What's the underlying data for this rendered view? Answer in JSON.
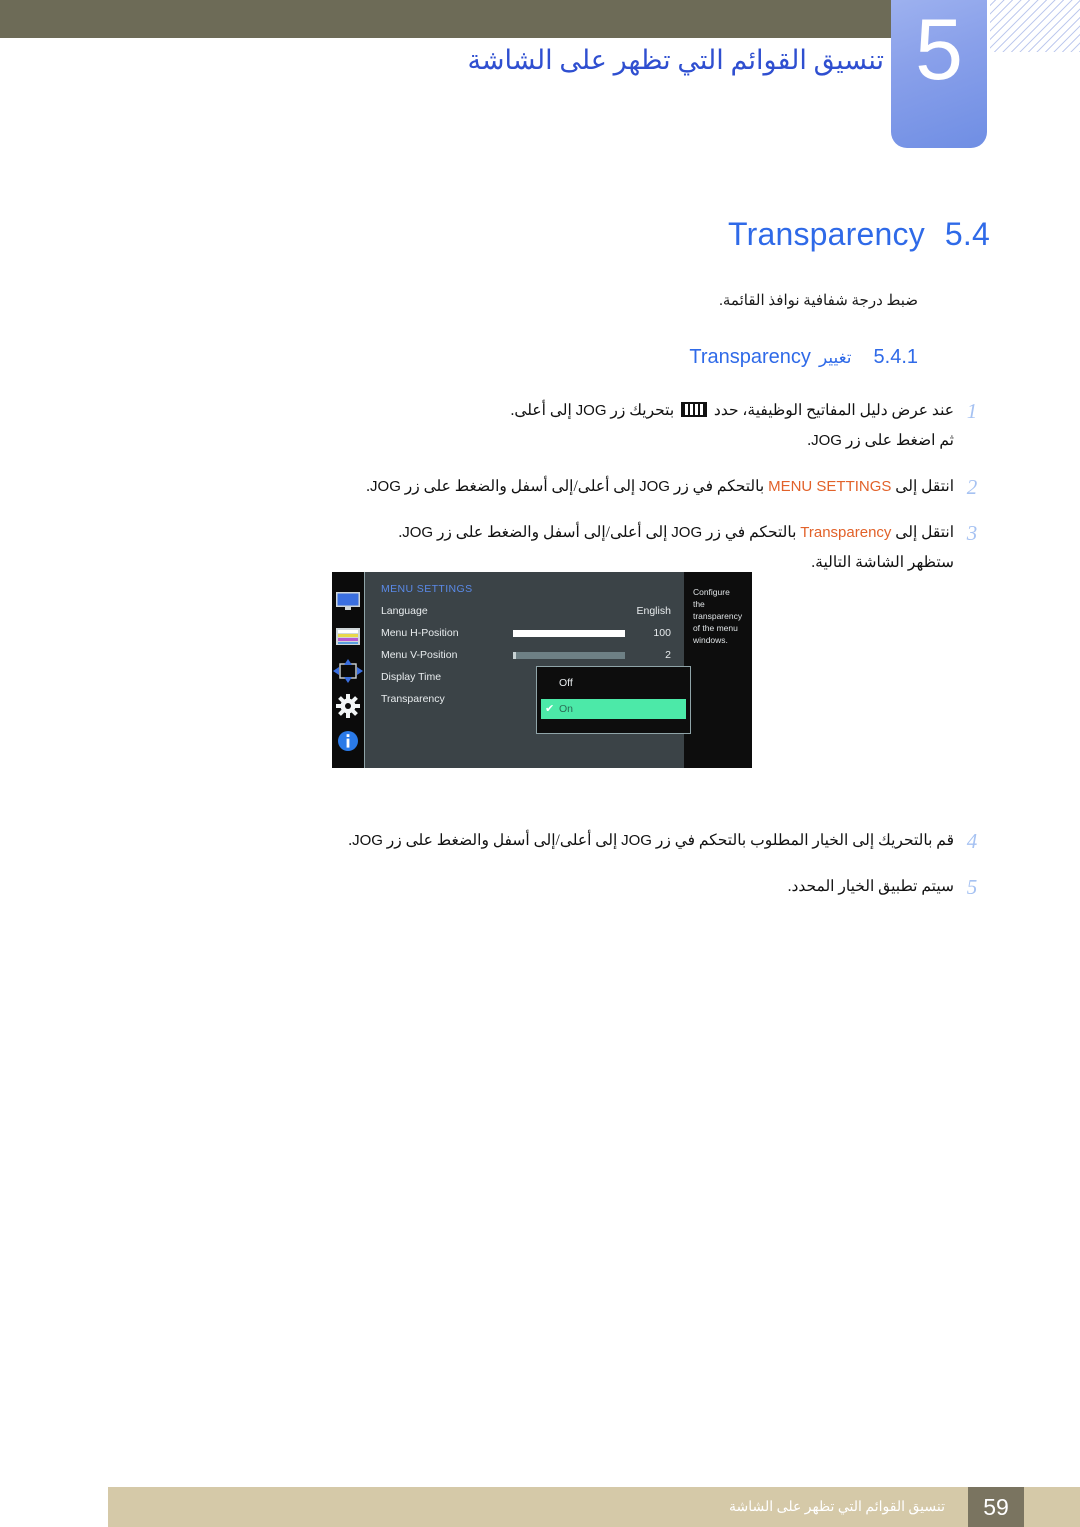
{
  "header": {
    "chapter_number": "5",
    "chapter_title": "تنسيق القوائم التي تظهر على الشاشة"
  },
  "section": {
    "number": "5.4",
    "title": "Transparency",
    "description": "ضبط درجة شفافية نوافذ القائمة."
  },
  "subsection": {
    "number": "5.4.1",
    "arabic_label": "تغيير",
    "english_label": "Transparency"
  },
  "steps": [
    {
      "number": "1",
      "line1_a": "عند عرض دليل المفاتيح الوظيفية، حدد ",
      "icon": "menu-bars-icon",
      "line1_b": " بتحريك زر ",
      "jog": "JOG",
      "line1_c": " إلى أعلى.",
      "line2_a": "ثم اضغط على زر ",
      "line2_jog": "JOG",
      "line2_b": "."
    },
    {
      "number": "2",
      "text_a": "انتقل إلى ",
      "highlight": "MENU SETTINGS",
      "text_b": " بالتحكم في زر ",
      "jog1": "JOG",
      "text_c": " إلى أعلى/إلى أسفل والضغط على زر ",
      "jog2": "JOG",
      "text_d": "."
    },
    {
      "number": "3",
      "text_a": "انتقل إلى ",
      "highlight": "Transparency",
      "text_b": " بالتحكم في زر ",
      "jog1": "JOG",
      "text_c": " إلى أعلى/إلى أسفل والضغط على زر ",
      "jog2": "JOG",
      "text_d": ".",
      "line2": "ستظهر الشاشة التالية."
    },
    {
      "number": "4",
      "text_a": "قم بالتحريك إلى الخيار المطلوب بالتحكم في زر ",
      "jog1": "JOG",
      "text_c": " إلى أعلى/إلى أسفل والضغط على زر ",
      "jog2": "JOG",
      "text_d": "."
    },
    {
      "number": "5",
      "text_a": "سيتم تطبيق الخيار المحدد."
    }
  ],
  "osd": {
    "menu_title": "MENU SETTINGS",
    "sidebar_icons": [
      "monitor-icon",
      "color-bars-icon",
      "position-arrows-icon",
      "gear-icon",
      "info-icon"
    ],
    "rows": [
      {
        "label": "Language",
        "value": "English",
        "slider": false
      },
      {
        "label": "Menu H-Position",
        "value": "100",
        "slider": true,
        "fill_percent": 100
      },
      {
        "label": "Menu V-Position",
        "value": "2",
        "slider": true,
        "fill_percent": 2
      },
      {
        "label": "Display Time",
        "value": "",
        "slider": false
      },
      {
        "label": "Transparency",
        "value": "",
        "slider": false
      }
    ],
    "popup": {
      "options": [
        {
          "label": "Off",
          "selected": false
        },
        {
          "label": "On",
          "selected": true
        }
      ],
      "check_glyph": "✔"
    },
    "help_text": "Configure the transparency of the menu windows.",
    "colors": {
      "menu_title": "#5a8ae8",
      "panel": "#3b4347",
      "selected_row": "#4ce9a8",
      "sidebar": "#0b0b0b"
    }
  },
  "footer": {
    "text": "تنسيق القوائم التي تظهر على الشاشة",
    "page_number": "59"
  }
}
